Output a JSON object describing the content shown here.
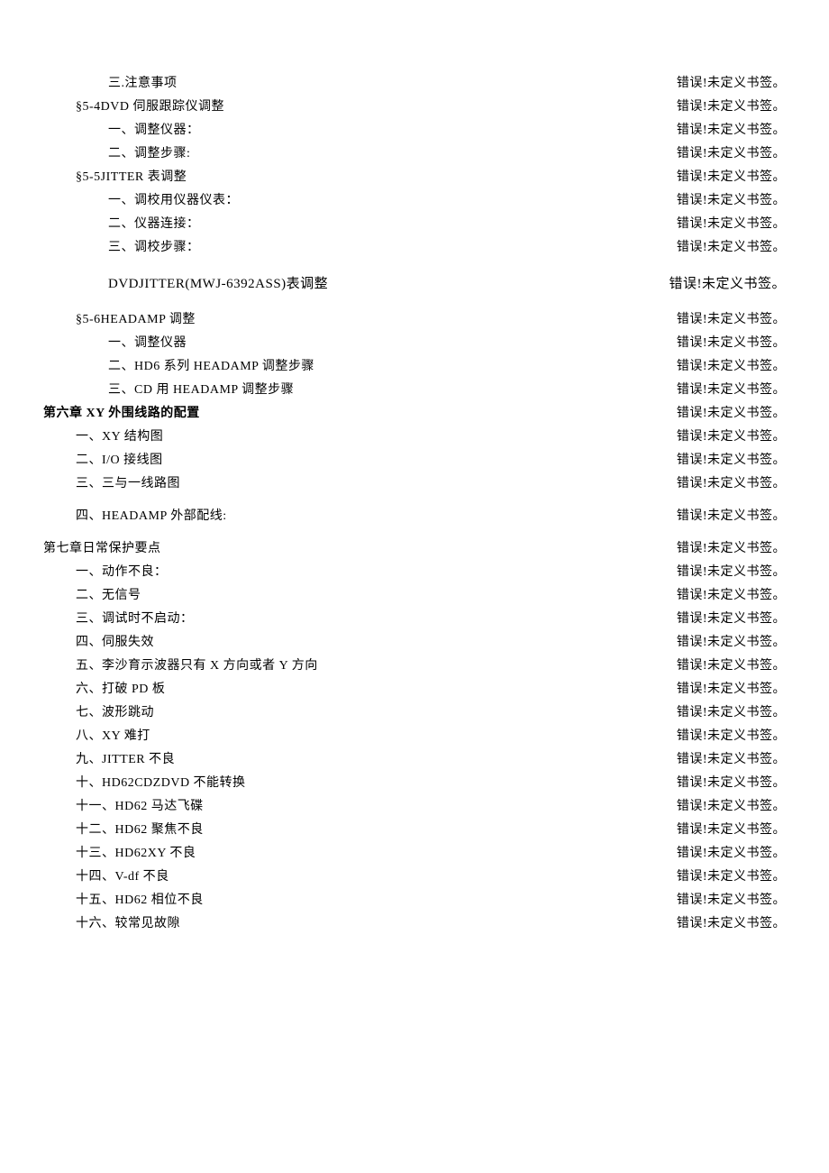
{
  "error_text": "错误!未定义书签。",
  "toc": [
    {
      "indent": 2,
      "title": "三.注意事项",
      "trailingSpace": true
    },
    {
      "indent": 1,
      "title": "§5-4DVD 伺服跟踪仪调整"
    },
    {
      "indent": 2,
      "title": "一、调整仪器："
    },
    {
      "indent": 2,
      "title": "二、调整步骤:"
    },
    {
      "indent": 1,
      "title": "§5-5JITTER 表调整"
    },
    {
      "indent": 2,
      "title": "一、调校用仪器仪表："
    },
    {
      "indent": 2,
      "title": "二、仪器连接："
    },
    {
      "indent": 2,
      "title": "三、调校步骤：",
      "gapAfter": true
    },
    {
      "indent": 2,
      "title": "DVDJITTER(MWJ-6392ASS)表调整",
      "special": true,
      "gapAfter": true
    },
    {
      "indent": 1,
      "title": "§5-6HEADAMP 调整"
    },
    {
      "indent": 2,
      "title": "一、调整仪器"
    },
    {
      "indent": 2,
      "title": "二、HD6 系列 HEADAMP 调整步骤"
    },
    {
      "indent": 2,
      "title": "三、CD 用 HEADAMP 调整步骤"
    },
    {
      "indent": 0,
      "title": "第六章 XY 外围线路的配置",
      "bold": true
    },
    {
      "indent": 1,
      "title": "一、XY 结构图"
    },
    {
      "indent": 1,
      "title": "二、I/O 接线图"
    },
    {
      "indent": 1,
      "title": "三、三与一线路图",
      "gapAfter": true
    },
    {
      "indent": 1,
      "title": "四、HEADAMP 外部配线:",
      "gapAfter": true
    },
    {
      "indent": 0,
      "title": "第七章日常保护要点"
    },
    {
      "indent": 1,
      "title": "一、动作不良："
    },
    {
      "indent": 1,
      "title": "二、无信号"
    },
    {
      "indent": 1,
      "title": "三、调试时不启动："
    },
    {
      "indent": 1,
      "title": "四、伺服失效"
    },
    {
      "indent": 1,
      "title": "五、李沙育示波器只有 X 方向或者 Y 方向"
    },
    {
      "indent": 1,
      "title": "六、打破 PD 板"
    },
    {
      "indent": 1,
      "title": "七、波形跳动"
    },
    {
      "indent": 1,
      "title": "八、XY 难打"
    },
    {
      "indent": 1,
      "title": "九、JITTER 不良"
    },
    {
      "indent": 1,
      "title": "十、HD62CDZDVD 不能转换"
    },
    {
      "indent": 1,
      "title": "十一、HD62 马达飞碟"
    },
    {
      "indent": 1,
      "title": "十二、HD62 聚焦不良"
    },
    {
      "indent": 1,
      "title": "十三、HD62XY 不良"
    },
    {
      "indent": 1,
      "title": "十四、V-df 不良"
    },
    {
      "indent": 1,
      "title": "十五、HD62 相位不良"
    },
    {
      "indent": 1,
      "title": "十六、较常见故隙"
    }
  ]
}
